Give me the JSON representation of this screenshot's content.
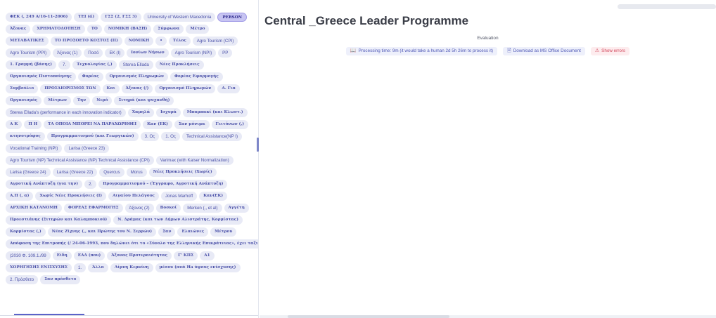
{
  "tags": [
    {
      "label": "ΦΕΚ (, 249 Α/16-11-2006)",
      "serif": true
    },
    {
      "label": "ΤΕΙ (ά)",
      "serif": true
    },
    {
      "label": "ΓΣΣ (2, ΓΣΣ 3)",
      "serif": true
    },
    {
      "label": "University of Western Macedonia",
      "serif": false
    },
    {
      "label": "PERSON",
      "serif": true,
      "active": true
    },
    {
      "label": "Άξονας",
      "serif": true
    },
    {
      "label": "ΧΡΗΜΑΤΟΔΟΤΗΣΗ",
      "serif": true
    },
    {
      "label": "ΤΟ",
      "serif": true
    },
    {
      "label": "ΝΟΜΙΚΗ (ΒΑΣΗ)",
      "serif": true
    },
    {
      "label": "Σύμφωνα",
      "serif": true
    },
    {
      "label": "Μέτρο",
      "serif": true
    },
    {
      "label": "ΜΕΤΑΒΑΤΙΚΕΣ",
      "serif": true
    },
    {
      "label": "ΤΟ ΠΡΟΣΟΕΤΟ ΚΟΣΤΟΣ (ΙΙ)",
      "serif": true
    },
    {
      "label": "ΝΟΜΙΚΗ",
      "serif": true
    },
    {
      "label": "•",
      "serif": true
    },
    {
      "label": "Τέλος",
      "serif": true
    },
    {
      "label": "Agro Tourism (CPI)",
      "serif": false
    },
    {
      "label": "Agro Tourism (PPI)",
      "serif": false
    },
    {
      "label": "Άξονας (1)",
      "serif": false
    },
    {
      "label": "Ποσό",
      "serif": false
    },
    {
      "label": "ΕΚ (Ι)",
      "serif": false
    },
    {
      "label": "Ιονίων Νήσων",
      "serif": true
    },
    {
      "label": "Agro Tourism (NPI)",
      "serif": false
    },
    {
      "label": "PP",
      "serif": false
    },
    {
      "label": "1. Γραμμή (βάσης)",
      "serif": true
    },
    {
      "label": "7.",
      "serif": false
    },
    {
      "label": "Τεχνολογίας (,)",
      "serif": true
    },
    {
      "label": "Sterea Ellada",
      "serif": false
    },
    {
      "label": "Νέες Προκλήσεις",
      "serif": true
    },
    {
      "label": "Οργανισμός Πιστοποίησης",
      "serif": true
    },
    {
      "label": "Φορέας",
      "serif": true
    },
    {
      "label": "Οργανισμός Πληρωμών",
      "serif": true
    },
    {
      "label": "Φορέας Εφαρμογής",
      "serif": true
    },
    {
      "label": "Συμβούλιο",
      "serif": true
    },
    {
      "label": "ΠΡΟΣΔΙΟΡΙΣΜΟΣ ΤΩΝ",
      "serif": true
    },
    {
      "label": "Και",
      "serif": true
    },
    {
      "label": "Άξονας (/)",
      "serif": true
    },
    {
      "label": "Οργανισμό Πληρωμών",
      "serif": true
    },
    {
      "label": "Α. Για",
      "serif": true
    },
    {
      "label": "Οργανισμός",
      "serif": true
    },
    {
      "label": "Μέτρων",
      "serif": true
    },
    {
      "label": "Την",
      "serif": true
    },
    {
      "label": "Νερό",
      "serif": true
    },
    {
      "label": "Σιτηρά (και ψυχανθή)",
      "serif": true
    },
    {
      "label": "Sterea Ellada's (performance in each innovation indicator)",
      "serif": false
    },
    {
      "label": "Χαμηλά",
      "serif": true
    },
    {
      "label": "Ισχυρά",
      "serif": true
    },
    {
      "label": "Μπαμπακί (και Κλωστ.)",
      "serif": true
    },
    {
      "label": "Α Κ",
      "serif": true
    },
    {
      "label": "Π Η",
      "serif": true
    },
    {
      "label": "ΤΑ ΟΠΟΙΑ ΜΠΟΡΕΙ ΝΑ ΠΑΡΑΧΩΡΗΘΕΙ",
      "serif": true
    },
    {
      "label": "Καν (ΕΚ)",
      "serif": true
    },
    {
      "label": "Σαν μόνιμα",
      "serif": true
    },
    {
      "label": "Γειτόνων (,)",
      "serif": true
    },
    {
      "label": "κτηνοτρόφος",
      "serif": true
    },
    {
      "label": "Προγραμματισμού (και Γεωργικών)",
      "serif": true
    },
    {
      "label": "3. Ος",
      "serif": false
    },
    {
      "label": "1. Ος",
      "serif": false
    },
    {
      "label": "Technical Assistance(NP I)",
      "serif": false
    },
    {
      "label": "Vocational Training (NPI)",
      "serif": false
    },
    {
      "label": "Larisa (Greece 23)",
      "serif": false
    },
    {
      "label": "Agro Tourism (NP) Technical Assistance (NP) Technical Assistance (CPI)",
      "serif": false
    },
    {
      "label": "Varimax (with Kaiser Normalization)",
      "serif": false
    },
    {
      "label": "Larisa (Greece 24)",
      "serif": false
    },
    {
      "label": "Larisa (Greece 22)",
      "serif": false
    },
    {
      "label": "Quercus",
      "serif": false
    },
    {
      "label": "Morus",
      "serif": false
    },
    {
      "label": "Νέες Προκλήσεις (Χωρίς)",
      "serif": true
    },
    {
      "label": "Αγροτική Ανάπτυξη (για την)",
      "serif": true
    },
    {
      "label": "2.",
      "serif": false
    },
    {
      "label": "Προγραμματισμού – (Έγγραφο, Αγροτική Ανάπτυξη)",
      "serif": true
    },
    {
      "label": "Α.Π (, α)",
      "serif": true
    },
    {
      "label": "Χωρίς Νέες Προκλήσεις (Ι)",
      "serif": true
    },
    {
      "label": "Αιγαίου Πελάγους",
      "serif": true
    },
    {
      "label": "Jonas Marhoff",
      "serif": false
    },
    {
      "label": "Καν(ΕΚ)",
      "serif": true
    },
    {
      "label": "ΑΡΧΙΚΗ ΚΑΤΑΝΟΜΗ",
      "serif": true
    },
    {
      "label": "ΦΟΡΕΑΣ ΕΦΑΡΜΟΓΗΣ",
      "serif": true
    },
    {
      "label": "Άξονας (2)",
      "serif": false
    },
    {
      "label": "Βοσκοί",
      "serif": true
    },
    {
      "label": "Merken (,, et al)",
      "serif": false
    },
    {
      "label": "Αγγέτη",
      "serif": true
    },
    {
      "label": "Προεστιάνης (Σιτηρών και Καλαμποκιού)",
      "serif": true
    },
    {
      "label": "Ν. Δράμας (και των Δήμων Αλιστράτης, Κορμίστας)",
      "serif": true
    },
    {
      "label": "Κορμίστας (,)",
      "serif": true
    },
    {
      "label": "Νέας Ζίχνης (,, και Πρώτης του Ν. Σερρών)",
      "serif": true
    },
    {
      "label": "Σαν",
      "serif": true
    },
    {
      "label": "Ελαιώνες",
      "serif": true
    },
    {
      "label": "Μέτρου",
      "serif": true
    },
    {
      "label": "Απόφαση της Επιτροπής (/ 24-06-1993, που δηλώνει ότι το «Σύνολο της Ελληνικής Επικράτειας», έχει ταξινομη",
      "serif": true
    },
    {
      "label": "(2030 Φ. 109.1./99",
      "serif": false
    },
    {
      "label": "Είδη",
      "serif": true
    },
    {
      "label": "ΕΑΔ (που)",
      "serif": true
    },
    {
      "label": "Άξονας Προτεραιότητας",
      "serif": true
    },
    {
      "label": "Γ' ΚΠΣ",
      "serif": true
    },
    {
      "label": "Α1",
      "serif": true
    },
    {
      "label": "ΧΟΡΗΓΗΣΗΣ ΕΝΙΣΧΥΣΗΣ",
      "serif": true
    },
    {
      "label": "1.",
      "serif": false
    },
    {
      "label": "Άλλα",
      "serif": true
    },
    {
      "label": "Λίμνη Κερκίνη",
      "serif": true
    },
    {
      "label": "μέσου (ανά Ha ύψους ενίσχυσης)",
      "serif": true
    },
    {
      "label": "2. Πρόσθετο",
      "serif": false
    },
    {
      "label": "Σαν πρόσθετο",
      "serif": true
    }
  ],
  "main": {
    "title": "Central _Greece Leader Programme",
    "evaluation_label": "Evaluation",
    "processing_time": "Processing time: 9m (it would take a human 2d 5h 26m to process it)",
    "download_label": "Download as MS Office Document",
    "errors_label": "Show errors"
  },
  "colors": {
    "tag_bg": "#e8eaf6",
    "tag_text": "#4a50a8",
    "active_tag_bg": "#c7c4f2",
    "error_text": "#d2455a"
  },
  "icons": {
    "processing": "book-icon",
    "download": "document-icon",
    "errors": "warning-icon"
  }
}
